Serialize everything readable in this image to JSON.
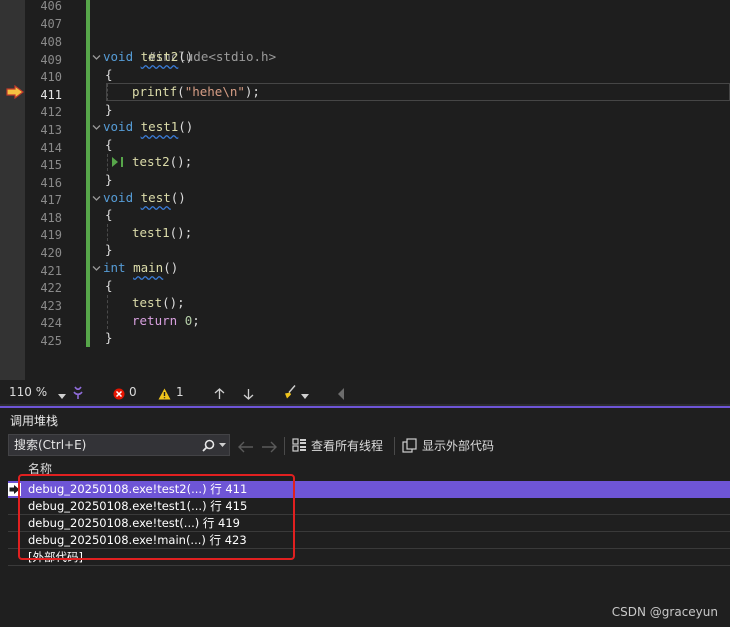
{
  "editor": {
    "lines": [
      {
        "n": "406"
      },
      {
        "n": "407"
      },
      {
        "n": "408"
      },
      {
        "n": "409"
      },
      {
        "n": "410"
      },
      {
        "n": "411"
      },
      {
        "n": "412"
      },
      {
        "n": "413"
      },
      {
        "n": "414"
      },
      {
        "n": "415"
      },
      {
        "n": "416"
      },
      {
        "n": "417"
      },
      {
        "n": "418"
      },
      {
        "n": "419"
      },
      {
        "n": "420"
      },
      {
        "n": "421"
      },
      {
        "n": "422"
      },
      {
        "n": "423"
      },
      {
        "n": "424"
      },
      {
        "n": "425"
      }
    ],
    "code": {
      "l408": "#include<stdio.h>",
      "l409_kw": "void",
      "l409_fn": "test2",
      "l409_rest": "()",
      "l410": "{",
      "l411_fn": "printf",
      "l411_open": "(",
      "l411_str": "\"hehe\\n\"",
      "l411_close": ");",
      "l412": "}",
      "l413_kw": "void",
      "l413_fn": "test1",
      "l413_rest": "()",
      "l414": "{",
      "l415_fn": "test2",
      "l415_rest": "();",
      "l416": "}",
      "l417_kw": "void",
      "l417_fn": "test",
      "l417_rest": "()",
      "l418": "{",
      "l419_fn": "test1",
      "l419_rest": "();",
      "l420": "}",
      "l421_kw": "int",
      "l421_fn": "main",
      "l421_rest": "()",
      "l422": "{",
      "l423_fn": "test",
      "l423_rest": "();",
      "l424_kw": "return",
      "l424_num": "0",
      "l424_rest": ";",
      "l425": "}"
    }
  },
  "status": {
    "zoom": "110 %",
    "errors": "0",
    "warnings": "1"
  },
  "callstack": {
    "title": "调用堆栈",
    "search_placeholder": "搜索(Ctrl+E)",
    "view_all_threads": "查看所有线程",
    "show_external_code": "显示外部代码",
    "column_name": "名称",
    "rows": [
      {
        "text": "debug_20250108.exe!test2(...) 行 411"
      },
      {
        "text": "debug_20250108.exe!test1(...) 行 415"
      },
      {
        "text": "debug_20250108.exe!test(...) 行 419"
      },
      {
        "text": "debug_20250108.exe!main(...) 行 423"
      },
      {
        "text": "[外部代码]"
      }
    ]
  },
  "colors": {
    "accent": "#6e55d6",
    "change_bar": "#57a64a",
    "annotation_box": "#e02020",
    "exec_arrow": "#f5c242"
  },
  "watermark": "CSDN @graceyun"
}
